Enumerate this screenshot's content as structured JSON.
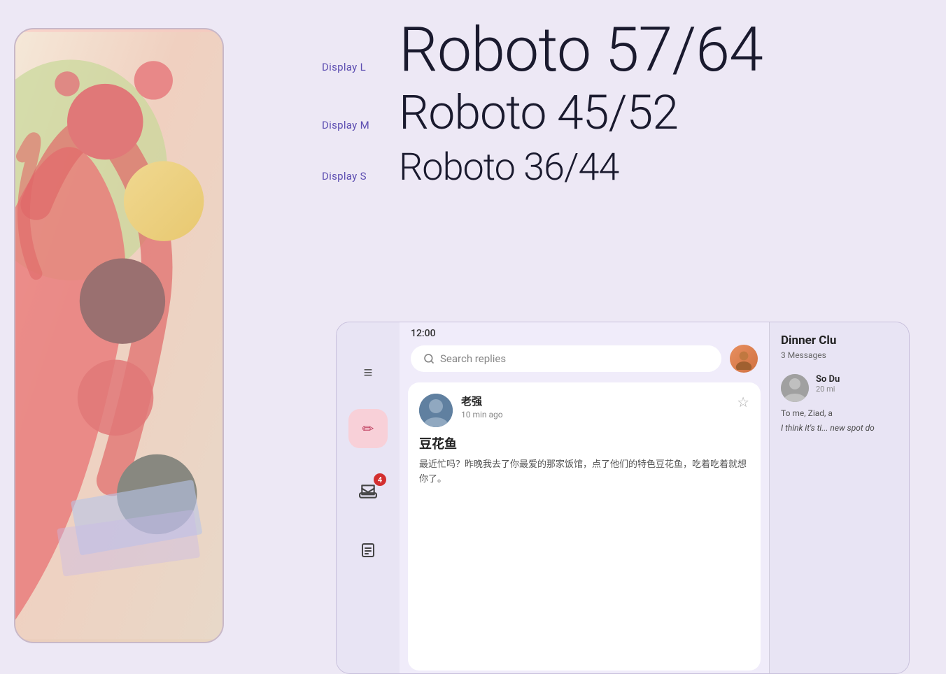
{
  "background_color": "#ede8f5",
  "typography": {
    "display_l": {
      "label": "Display L",
      "text": "Roboto 57/64",
      "font_size": "88px"
    },
    "display_m": {
      "label": "Display M",
      "text": "Roboto 45/52",
      "font_size": "68px"
    },
    "display_s": {
      "label": "Display S",
      "text": "Roboto 36/44",
      "font_size": "54px"
    }
  },
  "app": {
    "status_bar_time": "12:00",
    "search_placeholder": "Search replies",
    "sidebar_icons": [
      {
        "name": "hamburger",
        "symbol": "≡"
      },
      {
        "name": "compose",
        "symbol": "✏"
      },
      {
        "name": "inbox",
        "symbol": "📨",
        "badge": "4"
      },
      {
        "name": "notes",
        "symbol": "≡"
      }
    ],
    "message": {
      "sender": "老强",
      "time_ago": "10 min ago",
      "subject": "豆花鱼",
      "preview": "最近忙吗？昨晚我去了你最爱的那家饭馆，点了他们的特色豆花鱼，吃着吃着就想你了。"
    },
    "right_panel": {
      "title": "Dinner Clu",
      "subtitle": "3 Messages",
      "contact": {
        "name": "So Du",
        "time_ago": "20 mi",
        "preview": "To me, Ziad, a",
        "preview2": "I think it's ti... new spot do"
      }
    }
  }
}
